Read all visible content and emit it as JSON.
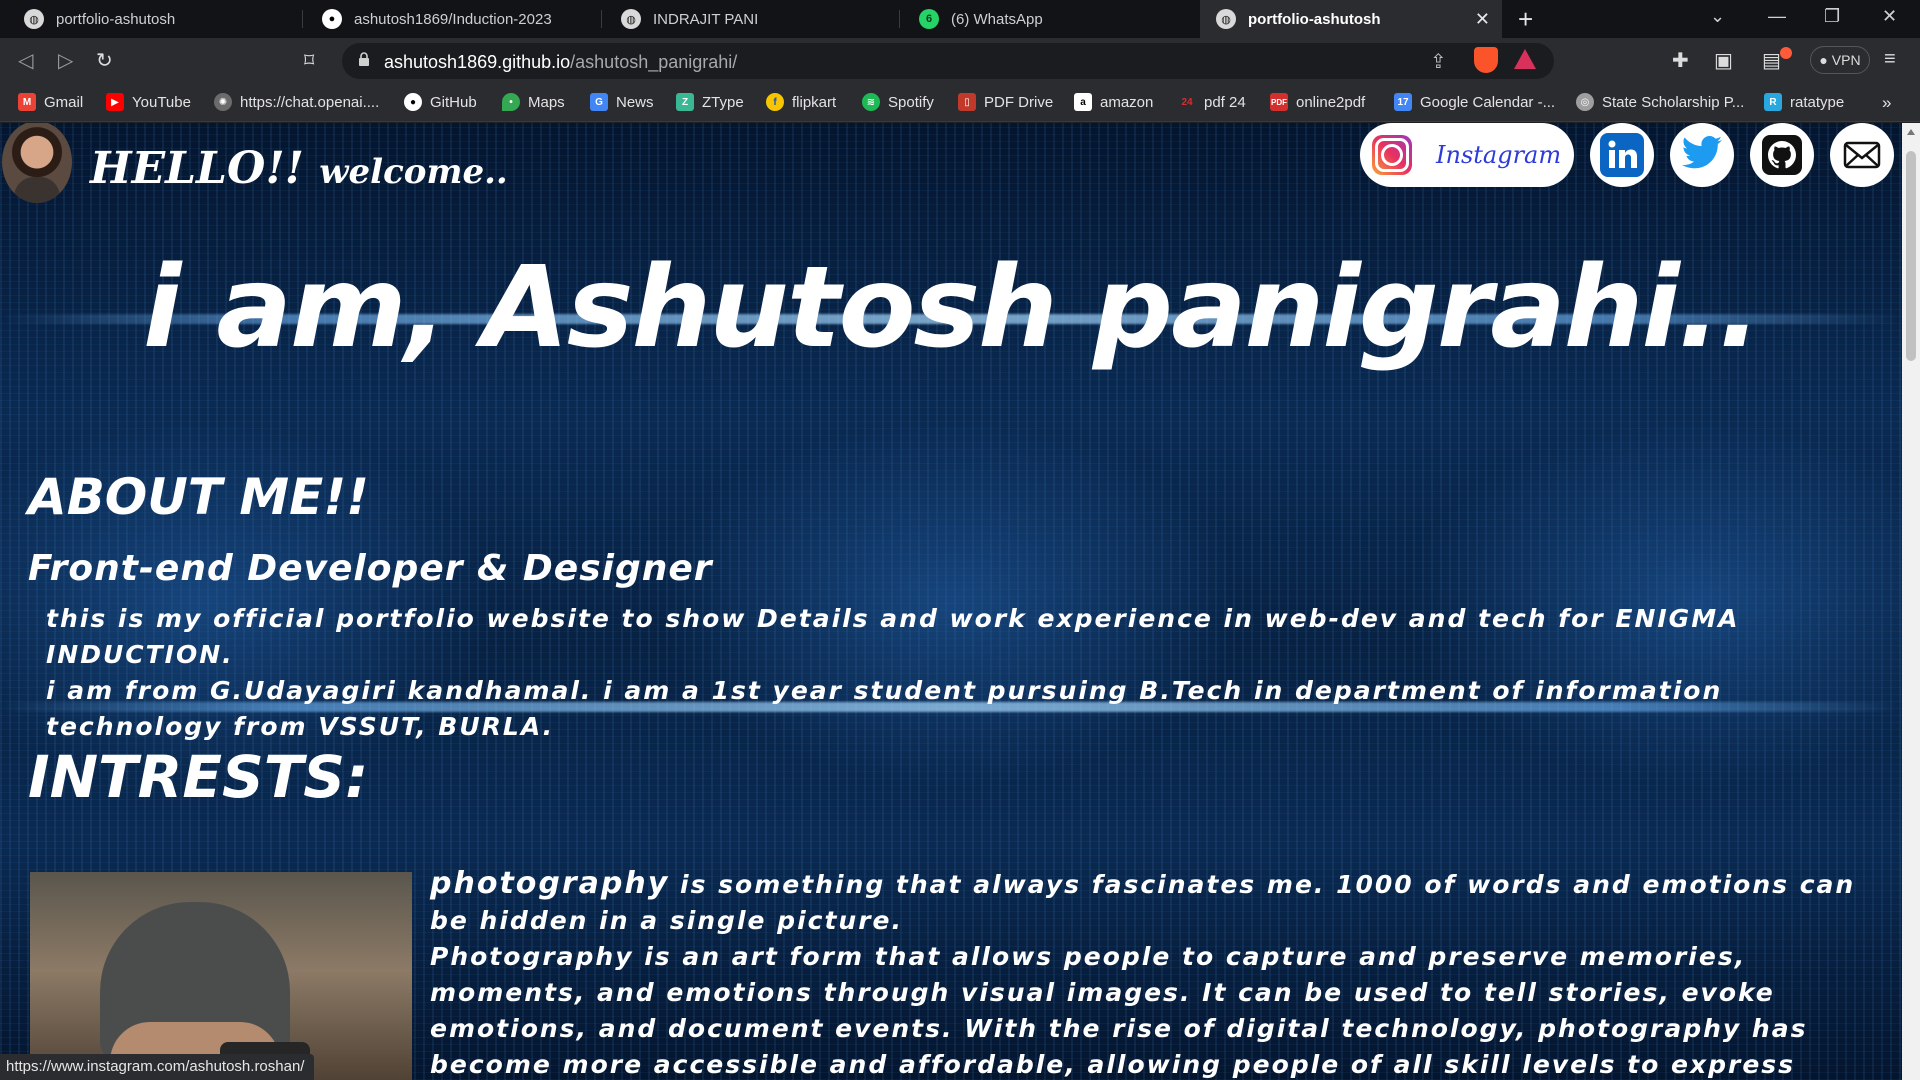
{
  "browser": {
    "tabs": [
      {
        "label": "portfolio-ashutosh",
        "icon": "globe-icon"
      },
      {
        "label": "ashutosh1869/Induction-2023",
        "icon": "github-icon"
      },
      {
        "label": "INDRAJIT PANI",
        "icon": "globe-icon"
      },
      {
        "label": "(6) WhatsApp",
        "icon": "whatsapp-icon",
        "badge": "6"
      },
      {
        "label": "portfolio-ashutosh",
        "icon": "globe-icon",
        "active": true
      }
    ],
    "url_host": "ashutosh1869.github.io",
    "url_path": "/ashutosh_panigrahi/",
    "vpn_label": "VPN",
    "bookmarks": [
      {
        "label": "Gmail",
        "icon": "gmail-icon",
        "color": "#ea4335"
      },
      {
        "label": "YouTube",
        "icon": "youtube-icon",
        "color": "#ff0000"
      },
      {
        "label": "https://chat.openai....",
        "icon": "openai-icon",
        "color": "#6b6b6b"
      },
      {
        "label": "GitHub",
        "icon": "github-icon",
        "color": "#ffffff"
      },
      {
        "label": "Maps",
        "icon": "maps-icon",
        "color": "#34a853"
      },
      {
        "label": "News",
        "icon": "news-icon",
        "color": "#4285f4"
      },
      {
        "label": "ZType",
        "icon": "ztype-icon",
        "color": "#3ab795"
      },
      {
        "label": "flipkart",
        "icon": "flipkart-icon",
        "color": "#f7c600"
      },
      {
        "label": "Spotify",
        "icon": "spotify-icon",
        "color": "#1db954"
      },
      {
        "label": "PDF Drive",
        "icon": "pdfdrive-icon",
        "color": "#c0392b"
      },
      {
        "label": "amazon",
        "icon": "amazon-icon",
        "color": "#ffffff"
      },
      {
        "label": "pdf 24",
        "icon": "pdf24-icon",
        "color": "#d32f2f"
      },
      {
        "label": "online2pdf",
        "icon": "online2pdf-icon",
        "color": "#d32f2f"
      },
      {
        "label": "Google Calendar -...",
        "icon": "calendar-icon",
        "color": "#4285f4"
      },
      {
        "label": "State Scholarship P...",
        "icon": "scholarship-icon",
        "color": "#9e9e9e"
      },
      {
        "label": "ratatype",
        "icon": "ratatype-icon",
        "color": "#29a8e0"
      }
    ],
    "status_url": "https://www.instagram.com/ashutosh.roshan/"
  },
  "page": {
    "hello": "HELLO!!",
    "welcome": "welcome..",
    "instagram_label": "Instagram",
    "social_icons": [
      "linkedin-icon",
      "twitter-icon",
      "github-icon",
      "mail-icon"
    ],
    "big_name": "i am, Ashutosh panigrahi..",
    "about_heading": "ABOUT ME!!",
    "role": "Front-end Developer & Designer",
    "about_line1": "this is my official portfolio website to show Details and work experience in web-dev and tech for ENIGMA INDUCTION.",
    "about_line2": "i am from G.Udayagiri kandhamal. i am a 1st year student pursuing B.Tech in department of information technology from VSSUT, BURLA.",
    "interests_heading": "INTRESTS:",
    "photo_lead": "photography",
    "photo_text1": " is something that always fascinates me. 1000 of words and emotions can be hidden in a single picture.",
    "photo_text2": "Photography is an art form that allows people to capture and preserve memories, moments, and emotions through visual images. It can be used to tell stories, evoke emotions, and document events. With the rise of digital technology, photography has become more accessible and affordable, allowing people of all skill levels to express themselves creatively. From stunning"
  },
  "colors": {
    "instagram_text": "#2d3bd8",
    "linkedin": "#0a66c2",
    "twitter": "#1d9bf0",
    "page_bg": "#0a2a52"
  }
}
